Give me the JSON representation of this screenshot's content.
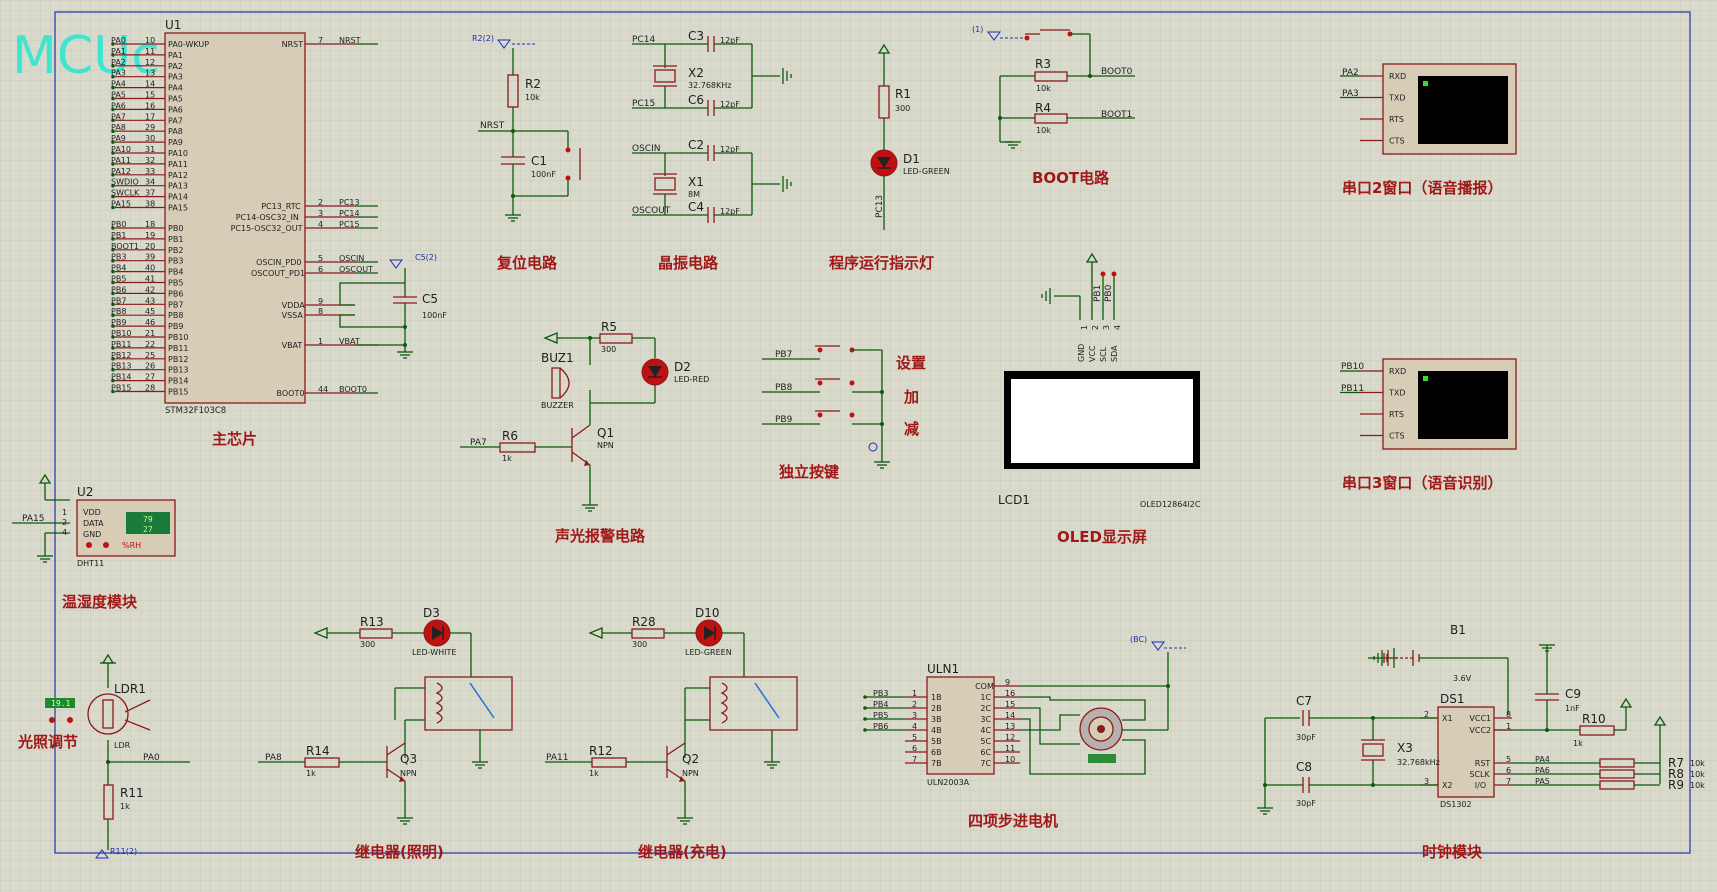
{
  "watermark": "MCUclub",
  "sections": {
    "main_chip": "主芯片",
    "reset": "复位电路",
    "crystal": "晶振电路",
    "run_led": "程序运行指示灯",
    "boot": "BOOT电路",
    "uart2": "串口2窗口（语音播报）",
    "uart3": "串口3窗口（语音识别）",
    "temp_hum": "温湿度模块",
    "buzzer": "声光报警电路",
    "keys": "独立按键",
    "oled": "OLED显示屏",
    "light": "光照调节",
    "relay_light": "继电器(照明)",
    "relay_charge": "继电器(充电)",
    "stepper": "四项步进电机",
    "clock": "时钟模块",
    "key_set": "设置",
    "key_add": "加",
    "key_sub": "减"
  },
  "mcu": {
    "ref": "U1",
    "part": "STM32F103C8",
    "left_pins": [
      {
        "name": "PA0-WKUP",
        "num": "10",
        "net": "PA0"
      },
      {
        "name": "PA1",
        "num": "11",
        "net": "PA1"
      },
      {
        "name": "PA2",
        "num": "12",
        "net": "PA2"
      },
      {
        "name": "PA3",
        "num": "13",
        "net": "PA3"
      },
      {
        "name": "PA4",
        "num": "14",
        "net": "PA4"
      },
      {
        "name": "PA5",
        "num": "15",
        "net": "PA5"
      },
      {
        "name": "PA6",
        "num": "16",
        "net": "PA6"
      },
      {
        "name": "PA7",
        "num": "17",
        "net": "PA7"
      },
      {
        "name": "PA8",
        "num": "29",
        "net": "PA8"
      },
      {
        "name": "PA9",
        "num": "30",
        "net": "PA9"
      },
      {
        "name": "PA10",
        "num": "31",
        "net": "PA10"
      },
      {
        "name": "PA11",
        "num": "32",
        "net": "PA11"
      },
      {
        "name": "PA12",
        "num": "33",
        "net": "PA12"
      },
      {
        "name": "PA13",
        "num": "34",
        "net": "SWDIO"
      },
      {
        "name": "PA14",
        "num": "37",
        "net": "SWCLK"
      },
      {
        "name": "PA15",
        "num": "38",
        "net": "PA15"
      },
      {
        "name": "PB0",
        "num": "18",
        "net": "PB0"
      },
      {
        "name": "PB1",
        "num": "19",
        "net": "PB1"
      },
      {
        "name": "PB2",
        "num": "20",
        "net": "BOOT1"
      },
      {
        "name": "PB3",
        "num": "39",
        "net": "PB3"
      },
      {
        "name": "PB4",
        "num": "40",
        "net": "PB4"
      },
      {
        "name": "PB5",
        "num": "41",
        "net": "PB5"
      },
      {
        "name": "PB6",
        "num": "42",
        "net": "PB6"
      },
      {
        "name": "PB7",
        "num": "43",
        "net": "PB7"
      },
      {
        "name": "PB8",
        "num": "45",
        "net": "PB8"
      },
      {
        "name": "PB9",
        "num": "46",
        "net": "PB9"
      },
      {
        "name": "PB10",
        "num": "21",
        "net": "PB10"
      },
      {
        "name": "PB11",
        "num": "22",
        "net": "PB11"
      },
      {
        "name": "PB12",
        "num": "25",
        "net": "PB12"
      },
      {
        "name": "PB13",
        "num": "26",
        "net": "PB13"
      },
      {
        "name": "PB14",
        "num": "27",
        "net": "PB14"
      },
      {
        "name": "PB15",
        "num": "28",
        "net": "PB15"
      }
    ],
    "right_pins": [
      {
        "name": "NRST",
        "num": "7",
        "net": "NRST"
      },
      {
        "name": "PC13_RTC",
        "num": "2",
        "net": "PC13"
      },
      {
        "name": "PC14-OSC32_IN",
        "num": "3",
        "net": "PC14"
      },
      {
        "name": "PC15-OSC32_OUT",
        "num": "4",
        "net": "PC15"
      },
      {
        "name": "OSCIN_PD0",
        "num": "5",
        "net": "OSCIN"
      },
      {
        "name": "OSCOUT_PD1",
        "num": "6",
        "net": "OSCOUT"
      },
      {
        "name": "VDDA",
        "num": "9",
        "net": ""
      },
      {
        "name": "VSSA",
        "num": "8",
        "net": ""
      },
      {
        "name": "VBAT",
        "num": "1",
        "net": "VBAT"
      },
      {
        "name": "BOOT0",
        "num": "44",
        "net": "BOOT0"
      }
    ],
    "c5": {
      "ref": "C5",
      "value": "100nF",
      "probe": "C5(2)"
    }
  },
  "reset": {
    "r_ref": "R2",
    "r_val": "10k",
    "c_ref": "C1",
    "c_val": "100nF",
    "net": "NRST",
    "probe": "R2(2)"
  },
  "crystal": {
    "c3": "C3",
    "c3v": "12pF",
    "x2": "X2",
    "x2v": "32.768KHz",
    "c6": "C6",
    "c6v": "12pF",
    "c2": "C2",
    "c2v": "12pF",
    "x1": "X1",
    "x1v": "8M",
    "c4": "C4",
    "c4v": "12pF",
    "nets": [
      "PC14",
      "PC15",
      "OSCIN",
      "OSCOUT"
    ]
  },
  "run_led": {
    "r": "R1",
    "rv": "300",
    "d": "D1",
    "dv": "LED-GREEN",
    "net": "PC13"
  },
  "boot": {
    "r3": "R3",
    "r3v": "10k",
    "r4": "R4",
    "r4v": "10k",
    "n0": "BOOT0",
    "n1": "BOOT1",
    "probe": "(1)"
  },
  "uart2": {
    "pins": [
      "RXD",
      "TXD",
      "RTS",
      "CTS"
    ],
    "nets": [
      "PA2",
      "PA3"
    ]
  },
  "uart3": {
    "pins": [
      "RXD",
      "TXD",
      "RTS",
      "CTS"
    ],
    "nets": [
      "PB10",
      "PB11"
    ]
  },
  "dht": {
    "ref": "U2",
    "part": "DHT11",
    "pins": [
      "VDD",
      "DATA",
      "GND"
    ],
    "nums": [
      "1",
      "2",
      "4"
    ],
    "net": "PA15",
    "temp": "79",
    "hum": "27",
    "unit": "%RH"
  },
  "buzzer": {
    "r5": "R5",
    "r5v": "300",
    "d2": "D2",
    "d2v": "LED-RED",
    "buz": "BUZ1",
    "buzv": "BUZZER",
    "q1": "Q1",
    "q1v": "NPN",
    "r6": "R6",
    "r6v": "1k",
    "net": "PA7"
  },
  "keys": {
    "nets": [
      "PB7",
      "PB8",
      "PB9"
    ]
  },
  "oled": {
    "pins": [
      "GND",
      "VCC",
      "SCL",
      "SDA"
    ],
    "nums": [
      "1",
      "2",
      "3",
      "4"
    ],
    "nets": [
      "PB1",
      "PB0"
    ],
    "ref": "LCD1",
    "part": "OLED12864I2C"
  },
  "ldr": {
    "ref": "LDR1",
    "part": "LDR",
    "value": "19.1",
    "r11": "R11",
    "r11v": "1k",
    "net": "PA0",
    "probe": "R11(2)"
  },
  "relay1": {
    "r13": "R13",
    "r13v": "300",
    "d3": "D3",
    "d3v": "LED-WHITE",
    "r14": "R14",
    "r14v": "1k",
    "q3": "Q3",
    "q3v": "NPN",
    "net": "PA8"
  },
  "relay2": {
    "r28": "R28",
    "r28v": "300",
    "d10": "D10",
    "d10v": "LED-GREEN",
    "r12": "R12",
    "r12v": "1k",
    "q2": "Q2",
    "q2v": "NPN",
    "net": "PA11"
  },
  "uln": {
    "ref": "ULN1",
    "part": "ULN2003A",
    "in": [
      "1B",
      "2B",
      "3B",
      "4B",
      "5B",
      "6B",
      "7B"
    ],
    "out": [
      "COM",
      "1C",
      "2C",
      "3C",
      "4C",
      "5C",
      "6C",
      "7C"
    ],
    "innum": [
      "1",
      "2",
      "3",
      "4",
      "5",
      "6",
      "7"
    ],
    "outnum": [
      "9",
      "16",
      "15",
      "14",
      "13",
      "12",
      "11",
      "10"
    ],
    "nets": [
      "PB3",
      "PB4",
      "PB5",
      "PB6"
    ],
    "probe": "(BC)"
  },
  "clock": {
    "b1": "B1",
    "b1v": "3.6V",
    "c7": "C7",
    "c7v": "30pF",
    "c8": "C8",
    "c8v": "30pF",
    "x3": "X3",
    "x3v": "32.768kHz",
    "ds": "DS1",
    "dsv": "DS1302",
    "c9": "C9",
    "c9v": "1nF",
    "r10": "R10",
    "r10v": "1k",
    "pins": [
      "X1",
      "X2",
      "VCC1",
      "VCC2",
      "RST",
      "SCLK",
      "I/O"
    ],
    "pinnums": [
      "2",
      "3",
      "8",
      "1",
      "5",
      "6",
      "7"
    ],
    "nets": [
      "PA4",
      "PA6",
      "PA5"
    ],
    "pull": [
      "R7",
      "R8",
      "R9"
    ],
    "pullv": "10k"
  }
}
